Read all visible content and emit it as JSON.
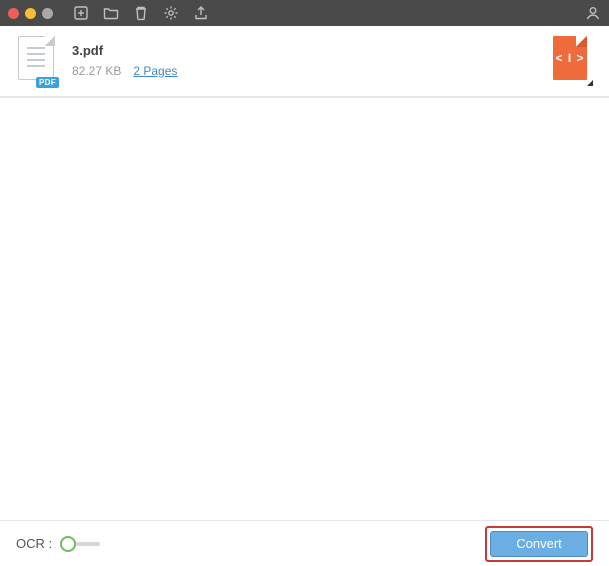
{
  "toolbar": {
    "icons": [
      "add-file-icon",
      "open-folder-icon",
      "trash-icon",
      "gear-icon",
      "share-icon"
    ],
    "account_icon": "account-icon"
  },
  "file": {
    "name": "3.pdf",
    "size": "82.27 KB",
    "pages_label": "2 Pages",
    "badge": "PDF",
    "output_symbol": "< I >"
  },
  "footer": {
    "ocr_label": "OCR :",
    "ocr_on": false,
    "convert_label": "Convert"
  }
}
